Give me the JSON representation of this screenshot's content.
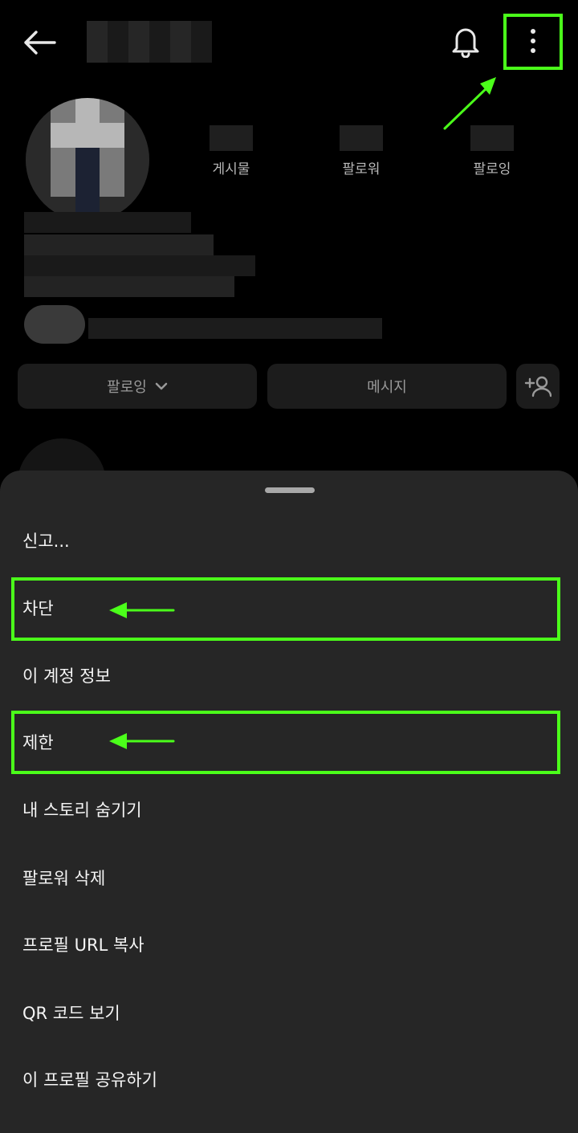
{
  "header": {
    "back_icon": "arrow-left-icon",
    "bell_icon": "bell-icon",
    "more_icon": "more-vertical-icon"
  },
  "profile": {
    "stats": [
      {
        "label": "게시물"
      },
      {
        "label": "팔로워"
      },
      {
        "label": "팔로잉"
      }
    ],
    "buttons": {
      "following_label": "팔로잉",
      "message_label": "메시지",
      "add_person_icon": "add-person-icon"
    }
  },
  "sheet": {
    "items": [
      {
        "label": "신고..."
      },
      {
        "label": "차단"
      },
      {
        "label": "이 계정 정보"
      },
      {
        "label": "제한"
      },
      {
        "label": "내 스토리 숨기기"
      },
      {
        "label": "팔로워 삭제"
      },
      {
        "label": "프로필 URL 복사"
      },
      {
        "label": "QR 코드 보기"
      },
      {
        "label": "이 프로필 공유하기"
      }
    ]
  },
  "colors": {
    "annotation": "#4bff1a",
    "sheet_bg": "#262626",
    "page_bg": "#000000"
  }
}
